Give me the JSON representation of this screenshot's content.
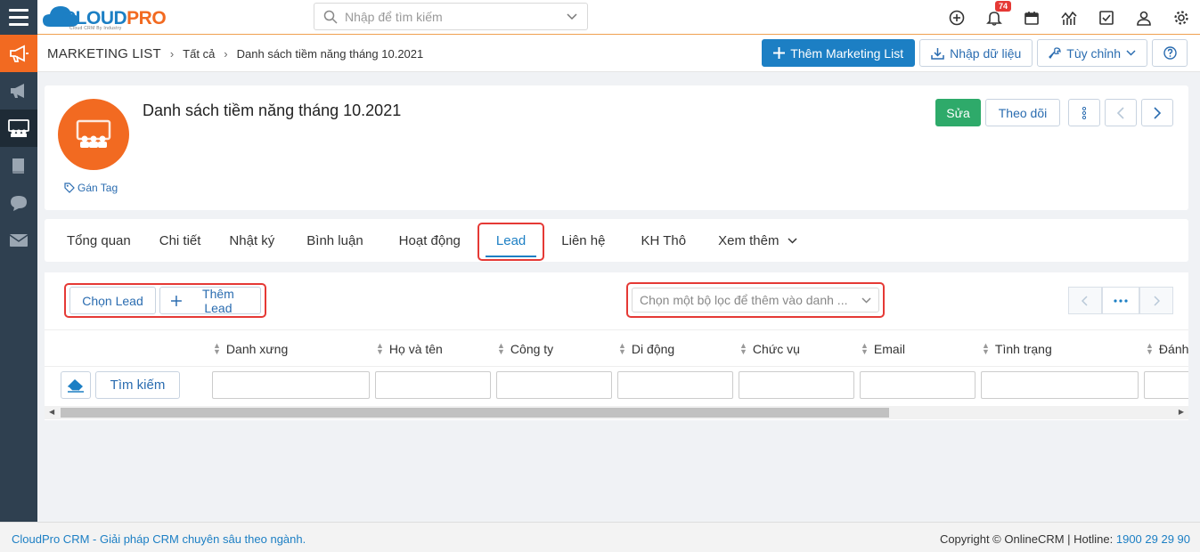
{
  "app": {
    "logo_main_1": "CLOUD",
    "logo_main_2": "PRO",
    "logo_sub": "Cloud CRM By Industry",
    "search_placeholder": "Nhập để tìm kiếm",
    "notification_count": "74"
  },
  "header": {
    "module": "MARKETING LIST",
    "breadcrumb_all": "Tất cả",
    "breadcrumb_current": "Danh sách tiềm năng tháng 10.2021",
    "add_button": "Thêm Marketing List",
    "import_button": "Nhập dữ liệu",
    "customize_button": "Tùy chỉnh"
  },
  "record": {
    "title": "Danh sách tiềm năng tháng 10.2021",
    "tag_label": "Gán Tag",
    "edit_button": "Sửa",
    "follow_button": "Theo dõi"
  },
  "tabs": [
    {
      "label": "Tổng quan"
    },
    {
      "label": "Chi tiết"
    },
    {
      "label": "Nhật ký"
    },
    {
      "label": "Bình luận"
    },
    {
      "label": "Hoạt động"
    },
    {
      "label": "Lead",
      "active": true
    },
    {
      "label": "Liên hệ"
    },
    {
      "label": "KH Thô"
    },
    {
      "label": "Xem thêm"
    }
  ],
  "list": {
    "select_button": "Chọn Lead",
    "add_button": "Thêm Lead",
    "filter_placeholder": "Chọn một bộ lọc để thêm vào danh ...",
    "search_button": "Tìm kiếm",
    "columns": [
      "Danh xưng",
      "Họ và tên",
      "Công ty",
      "Di động",
      "Chức vụ",
      "Email",
      "Tình trạng",
      "Đánh"
    ]
  },
  "footer": {
    "left": "CloudPro CRM - Giải pháp CRM chuyên sâu theo ngành.",
    "copyright": "Copyright © OnlineCRM | Hotline: ",
    "hotline": "1900 29 29 90"
  },
  "colors": {
    "brand_blue": "#1c7fc4",
    "brand_orange": "#f26a21",
    "sidebar": "#2f4050",
    "success": "#2eaa6a",
    "highlight_red": "#e53935"
  }
}
